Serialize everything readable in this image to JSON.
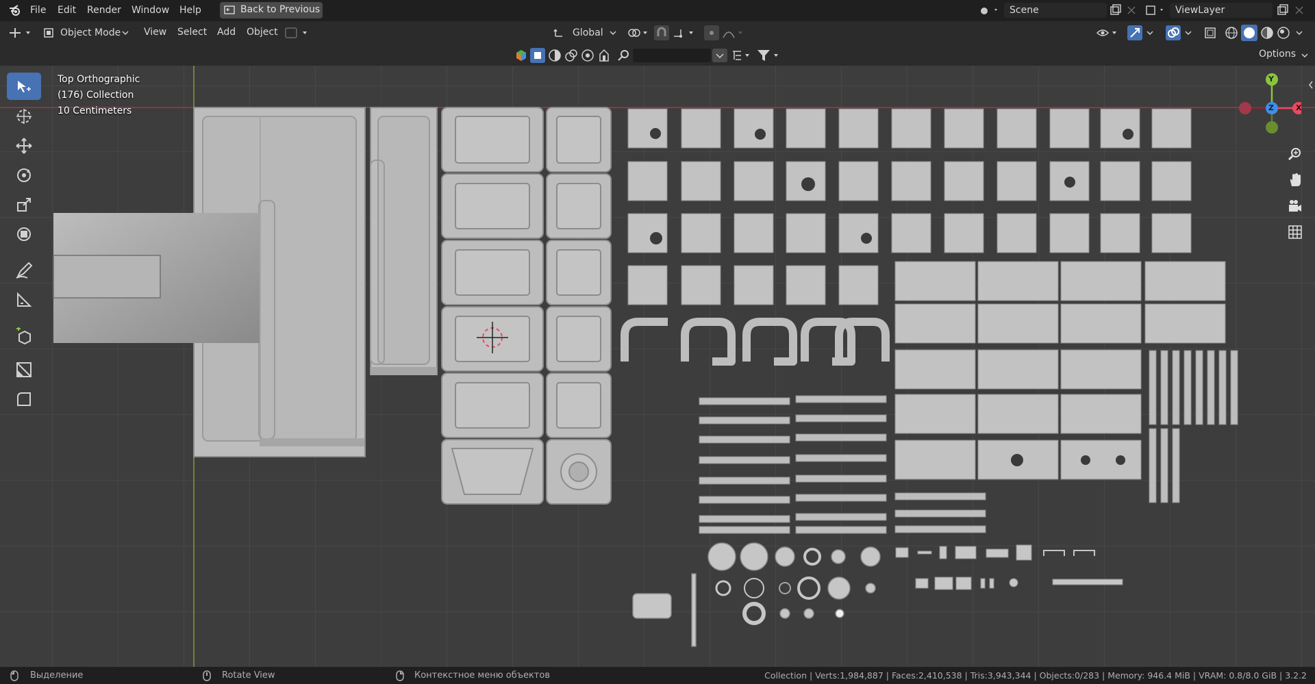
{
  "menu": {
    "items": [
      "File",
      "Edit",
      "Render",
      "Window",
      "Help"
    ],
    "back_button": "Back to Previous"
  },
  "scene": {
    "label": "Scene"
  },
  "view_layer": {
    "label": "ViewLayer"
  },
  "header": {
    "mode": "Object Mode",
    "menus": [
      "View",
      "Select",
      "Add",
      "Object"
    ],
    "orientation": "Global",
    "options": "Options"
  },
  "viewport": {
    "view_name": "Top Orthographic",
    "collection": "(176) Collection",
    "scale": "10 Centimeters"
  },
  "gizmo": {
    "y": "Y",
    "z": "Z",
    "x": "X"
  },
  "statusbar": {
    "hint1": "Выделение",
    "hint2": "Rotate View",
    "hint3": "Контекстное меню объектов",
    "stats": "Collection | Verts:1,984,887 | Faces:2,410,538 | Tris:3,943,344 | Objects:0/283 | Memory: 946.4 MiB | VRAM: 0.8/8.0 GiB | 3.2.2"
  },
  "colors": {
    "accent": "#4772b3",
    "x_axis": "#e84a5f",
    "y_axis": "#8bc53f",
    "z_axis": "#3f8fe8",
    "y_grid_line": "#7f9b3a",
    "x_grid_line": "#a23a44"
  },
  "icons": {
    "blender": "blender-logo-icon",
    "tools": [
      "select-box-icon",
      "cursor-icon",
      "move-icon",
      "rotate-icon",
      "scale-icon",
      "transform-icon",
      "annotate-icon",
      "measure-icon",
      "add-cube-icon",
      "uv-icon",
      "bevel-icon"
    ],
    "nav": [
      "zoom-icon",
      "pan-hand-icon",
      "camera-icon",
      "grid-icon"
    ]
  }
}
